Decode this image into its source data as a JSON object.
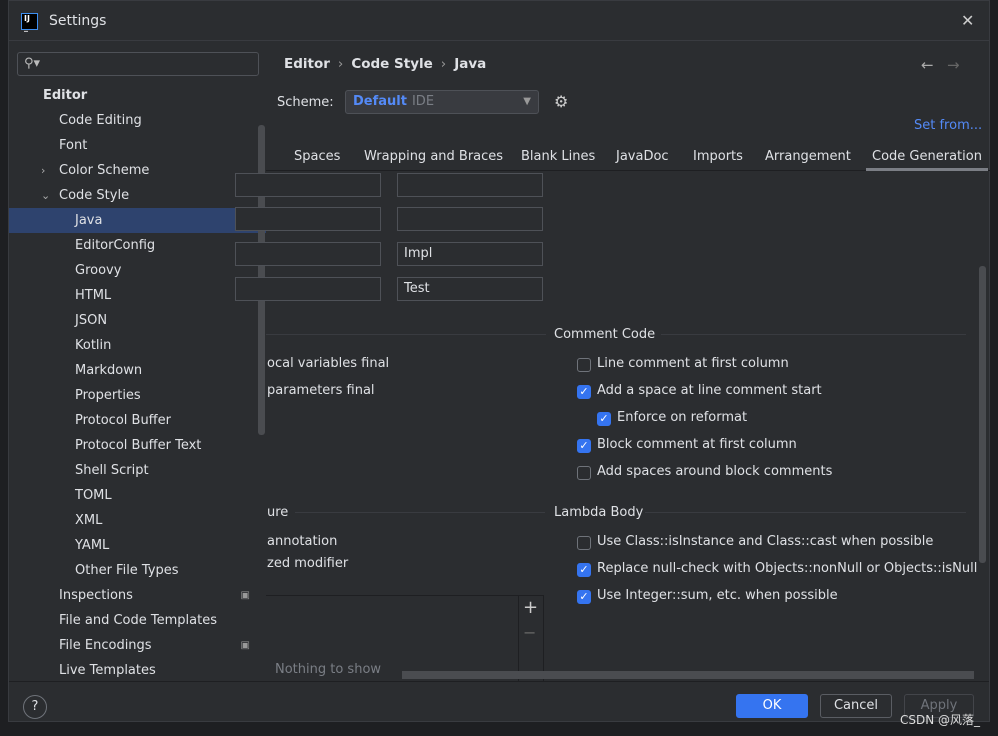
{
  "window": {
    "title": "Settings",
    "logo": "IJ"
  },
  "search": {
    "placeholder": "",
    "icon": "search-icon"
  },
  "sidebar": {
    "items": [
      {
        "label": "Editor",
        "level": 0,
        "bold": true
      },
      {
        "label": "Code Editing",
        "level": 1
      },
      {
        "label": "Font",
        "level": 1
      },
      {
        "label": "Color Scheme",
        "level": 1,
        "chevron": "›"
      },
      {
        "label": "Code Style",
        "level": 1,
        "chevron": "⌄"
      },
      {
        "label": "Java",
        "level": 2,
        "selected": true
      },
      {
        "label": "EditorConfig",
        "level": 2
      },
      {
        "label": "Groovy",
        "level": 2
      },
      {
        "label": "HTML",
        "level": 2
      },
      {
        "label": "JSON",
        "level": 2
      },
      {
        "label": "Kotlin",
        "level": 2
      },
      {
        "label": "Markdown",
        "level": 2
      },
      {
        "label": "Properties",
        "level": 2
      },
      {
        "label": "Protocol Buffer",
        "level": 2
      },
      {
        "label": "Protocol Buffer Text",
        "level": 2
      },
      {
        "label": "Shell Script",
        "level": 2
      },
      {
        "label": "TOML",
        "level": 2
      },
      {
        "label": "XML",
        "level": 2
      },
      {
        "label": "YAML",
        "level": 2
      },
      {
        "label": "Other File Types",
        "level": 2
      },
      {
        "label": "Inspections",
        "level": 1,
        "page": true
      },
      {
        "label": "File and Code Templates",
        "level": 1
      },
      {
        "label": "File Encodings",
        "level": 1,
        "page": true
      },
      {
        "label": "Live Templates",
        "level": 1
      }
    ]
  },
  "breadcrumb": [
    "Editor",
    "Code Style",
    "Java"
  ],
  "scheme": {
    "label": "Scheme:",
    "name": "Default",
    "type": "IDE",
    "set_from": "Set from..."
  },
  "tabs": [
    "Spaces",
    "Wrapping and Braces",
    "Blank Lines",
    "JavaDoc",
    "Imports",
    "Arrangement",
    "Code Generation"
  ],
  "active_tab": "Code Generation",
  "fields": {
    "suffix_rows": [
      "",
      "",
      "Impl",
      "Test"
    ]
  },
  "left_options": [
    "ocal variables final",
    "parameters final"
  ],
  "left_group2": {
    "title": "ure",
    "items": [
      "annotation",
      "zed modifier"
    ]
  },
  "list": {
    "empty": "Nothing to show",
    "add": "+",
    "remove": "−"
  },
  "comment_code": {
    "title": "Comment Code",
    "items": [
      {
        "label": "Line comment at first column",
        "checked": false,
        "indent": false
      },
      {
        "label": "Add a space at line comment start",
        "checked": true,
        "indent": false
      },
      {
        "label": "Enforce on reformat",
        "checked": true,
        "indent": true
      },
      {
        "label": "Block comment at first column",
        "checked": true,
        "indent": false
      },
      {
        "label": "Add spaces around block comments",
        "checked": false,
        "indent": false
      }
    ]
  },
  "lambda_body": {
    "title": "Lambda Body",
    "items": [
      {
        "label": "Use Class::isInstance and Class::cast when possible",
        "checked": false
      },
      {
        "label": "Replace null-check with Objects::nonNull or Objects::isNull",
        "checked": true
      },
      {
        "label": "Use Integer::sum, etc. when possible",
        "checked": true
      }
    ]
  },
  "footer": {
    "help": "?",
    "ok": "OK",
    "cancel": "Cancel",
    "apply": "Apply"
  },
  "watermark": "CSDN @风落_",
  "colors": {
    "accent": "#3574f0",
    "link": "#548af7",
    "bg": "#2b2d30",
    "selection": "#2e436e"
  }
}
